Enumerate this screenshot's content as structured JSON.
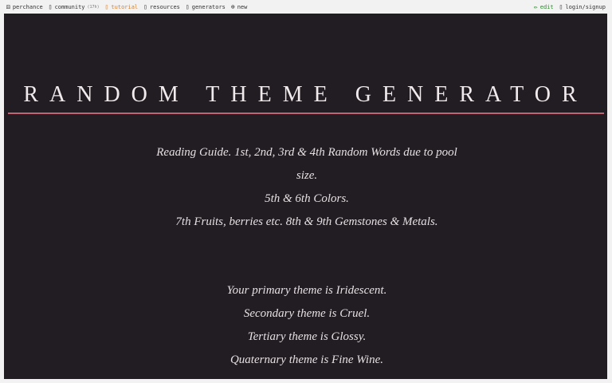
{
  "topbar": {
    "left": [
      {
        "name": "nav-perchance",
        "icon": "dice-icon",
        "glyph": "⚄",
        "label": "perchance"
      },
      {
        "name": "nav-community",
        "icon": "chat-icon",
        "glyph": "▯",
        "label": "community",
        "badge": "(17h)"
      },
      {
        "name": "nav-tutorial",
        "icon": "book-icon",
        "glyph": "▯",
        "label": "tutorial"
      },
      {
        "name": "nav-resources",
        "icon": "folder-icon",
        "glyph": "▯",
        "label": "resources"
      },
      {
        "name": "nav-generators",
        "icon": "grid-icon",
        "glyph": "▯",
        "label": "generators"
      },
      {
        "name": "nav-new",
        "icon": "plus-circle-icon",
        "glyph": "⊕",
        "label": "new"
      }
    ],
    "right": [
      {
        "name": "nav-edit",
        "icon": "pencil-icon",
        "glyph": "✏",
        "label": "edit"
      },
      {
        "name": "nav-login",
        "icon": "user-icon",
        "glyph": "▯",
        "label": "login/signup"
      }
    ]
  },
  "main": {
    "title": "RANDOM THEME GENERATOR",
    "guide": [
      "Reading Guide. 1st, 2nd, 3rd & 4th Random Words due to pool size.",
      "5th & 6th Colors.",
      "7th Fruits, berries etc. 8th & 9th Gemstones & Metals."
    ],
    "themes": [
      "Your primary theme is Iridescent.",
      "Secondary theme is Cruel.",
      "Tertiary theme is Glossy.",
      "Quaternary theme is Fine Wine."
    ]
  },
  "colors": {
    "background": "#221d22",
    "accent_rule": "#c06373",
    "tutorial_link": "#d9822b",
    "edit_link": "#2a8a2a"
  }
}
